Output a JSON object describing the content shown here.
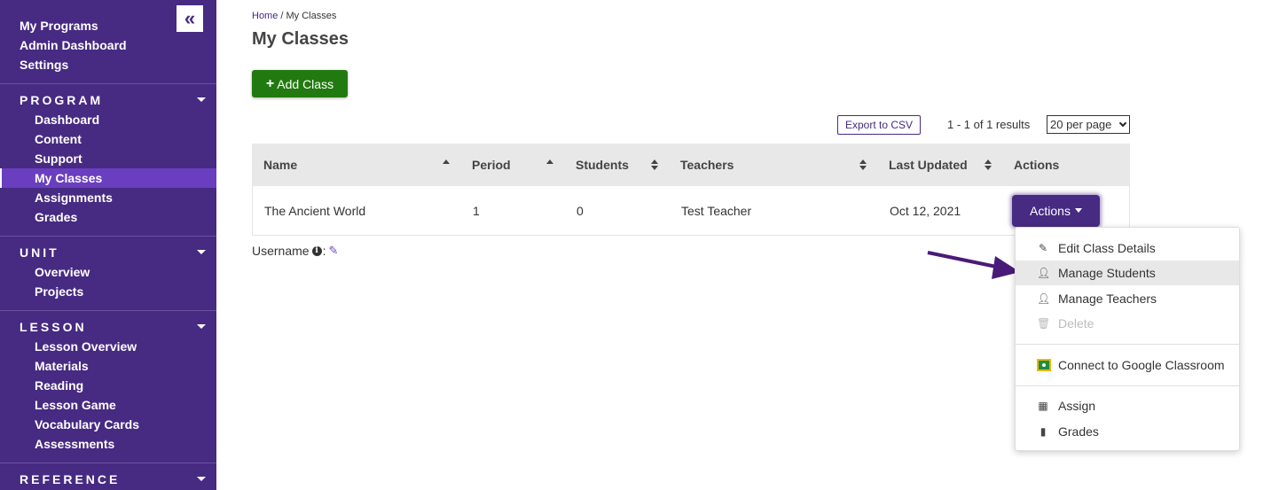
{
  "sidebar": {
    "collapse_icon": "double-chevron-left-icon",
    "top_links": [
      "My Programs",
      "Admin Dashboard",
      "Settings"
    ],
    "sections": [
      {
        "title": "PROGRAM",
        "items": [
          "Dashboard",
          "Content",
          "Support",
          "My Classes",
          "Assignments",
          "Grades"
        ],
        "active": "My Classes"
      },
      {
        "title": "UNIT",
        "items": [
          "Overview",
          "Projects"
        ]
      },
      {
        "title": "LESSON",
        "items": [
          "Lesson Overview",
          "Materials",
          "Reading",
          "Lesson Game",
          "Vocabulary Cards",
          "Assessments"
        ]
      },
      {
        "title": "REFERENCE",
        "items": []
      }
    ]
  },
  "breadcrumb": {
    "home": "Home",
    "separator": " / ",
    "current": "My Classes"
  },
  "page_title": "My Classes",
  "add_button": {
    "icon": "+",
    "label": "Add Class"
  },
  "toolbar": {
    "export_label": "Export to CSV",
    "results_text": "1 - 1 of 1 results",
    "per_page": "20 per page"
  },
  "table": {
    "headers": [
      "Name",
      "Period",
      "Students",
      "Teachers",
      "Last Updated",
      "Actions"
    ],
    "rows": [
      {
        "name": "The Ancient World",
        "period": "1",
        "students": "0",
        "teachers": "Test Teacher",
        "last_updated": "Oct 12, 2021",
        "action_label": "Actions"
      }
    ]
  },
  "username_label": "Username",
  "dropdown": {
    "items": [
      {
        "label": "Edit Class Details",
        "icon": "edit-icon"
      },
      {
        "label": "Manage Students",
        "icon": "user-icon",
        "highlighted": true
      },
      {
        "label": "Manage Teachers",
        "icon": "user-icon"
      },
      {
        "label": "Delete",
        "icon": "trash-icon",
        "disabled": true
      },
      {
        "label": "Connect to Google Classroom",
        "icon": "google-classroom-icon"
      },
      {
        "label": "Assign",
        "icon": "calendar-icon"
      },
      {
        "label": "Grades",
        "icon": "bar-chart-icon"
      }
    ]
  },
  "colors": {
    "brand": "#472a82",
    "active": "#6a3fbf",
    "add_button": "#217a0f"
  }
}
